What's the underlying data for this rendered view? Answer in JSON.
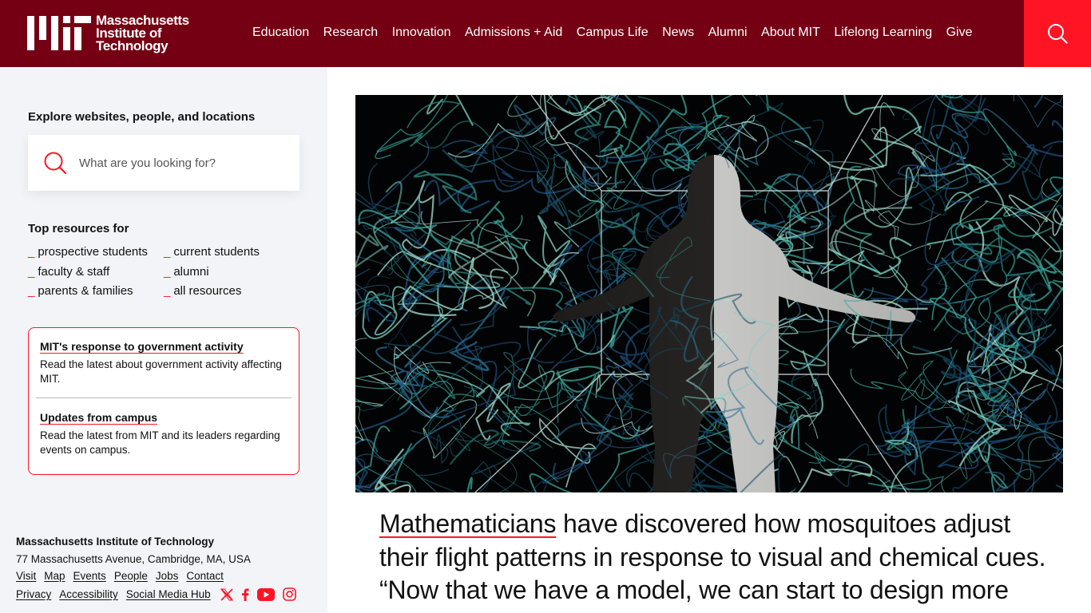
{
  "header": {
    "logo_lines": [
      "Massachusetts",
      "Institute of",
      "Technology"
    ],
    "nav": [
      "Education",
      "Research",
      "Innovation",
      "Admissions + Aid",
      "Campus Life",
      "News",
      "Alumni",
      "About MIT",
      "Lifelong Learning",
      "Give"
    ],
    "search_icon": "search-icon"
  },
  "sidebar": {
    "explore_title": "Explore websites, people, and locations",
    "search_placeholder": "What are you looking for?",
    "top_resources_title": "Top resources for",
    "resources": [
      "prospective students",
      "current students",
      "faculty & staff",
      "alumni",
      "parents & families",
      "all resources"
    ],
    "resource_bullet": "_",
    "alerts": [
      {
        "title": "MIT's response to government activity",
        "desc": "Read the latest about government activity affecting MIT."
      },
      {
        "title": "Updates from campus",
        "desc": "Read the latest from MIT and its leaders regarding events on campus."
      }
    ],
    "footer": {
      "institute": "Massachusetts Institute of Technology",
      "address": "77 Massachusetts Avenue, Cambridge, MA, USA",
      "links_row1": [
        "Visit",
        "Map",
        "Events",
        "People",
        "Jobs",
        "Contact"
      ],
      "links_row2": [
        "Privacy",
        "Accessibility",
        "Social Media Hub"
      ],
      "social_icons": [
        "x-icon",
        "facebook-icon",
        "youtube-icon",
        "instagram-icon"
      ]
    }
  },
  "main": {
    "hero_image": "airflow-simulation-figure-image",
    "headline_link": "Mathematicians",
    "headline_rest": " have discovered how mosquitoes adjust their flight patterns in response to visual and chemical cues. “Now that we have a model, we can start to design more"
  },
  "colors": {
    "header_bg": "#750014",
    "search_bg": "#ff1423",
    "accent": "#ff1423",
    "sidebar_bg": "#f2f4f8"
  }
}
